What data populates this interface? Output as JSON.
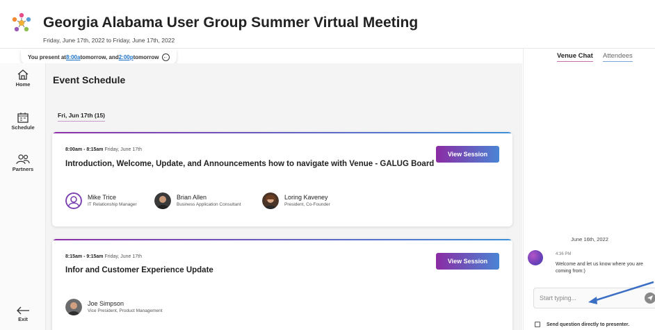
{
  "header": {
    "title": "Georgia Alabama User Group Summer Virtual Meeting",
    "dates": "Friday, June 17th, 2022 to Friday, June 17th, 2022"
  },
  "present": {
    "prefix": "You present at ",
    "time1": "8:00a",
    "mid": " tomorrow, and ",
    "time2": "2:00p",
    "suffix": " tomorrow"
  },
  "sidebar": {
    "items": [
      {
        "label": "Home",
        "icon": "home-icon"
      },
      {
        "label": "Schedule",
        "icon": "calendar-icon"
      },
      {
        "label": "Partners",
        "icon": "people-icon"
      }
    ],
    "exit_label": "Exit"
  },
  "main": {
    "section_title": "Event Schedule",
    "day_label": "Fri, Jun 17th (15)",
    "sessions": [
      {
        "time": "8:00am - 8:15am",
        "date": "Friday, June 17th",
        "title": "Introduction, Welcome, Update, and Announcements how to navigate with Venue - GALUG Board",
        "button": "View Session",
        "speakers": [
          {
            "name": "Mike Trice",
            "role": "IT Relationship Manager"
          },
          {
            "name": "Brian Allen",
            "role": "Business Application Consultant"
          },
          {
            "name": "Loring Kaveney",
            "role": "President, Co-Founder"
          }
        ]
      },
      {
        "time": "8:15am - 9:15am",
        "date": "Friday, June 17th",
        "title": "Infor and Customer Experience Update",
        "button": "View Session",
        "speakers": [
          {
            "name": "Joe Simpson",
            "role": "Vice President, Product Management"
          }
        ]
      }
    ]
  },
  "chat": {
    "tabs": [
      "Venue Chat",
      "Attendees"
    ],
    "date": "June 16th, 2022",
    "message": {
      "time": "4:36 PM",
      "text": "Welcome and let us know where you are coming from:)"
    },
    "placeholder": "Start typing...",
    "send_question_label": "Send question directly to presenter."
  },
  "colors": {
    "accent_purple": "#8b2ca4",
    "accent_blue": "#4a84d4",
    "link": "#1d73c9",
    "annotation_arrow": "#3b6fc4"
  }
}
